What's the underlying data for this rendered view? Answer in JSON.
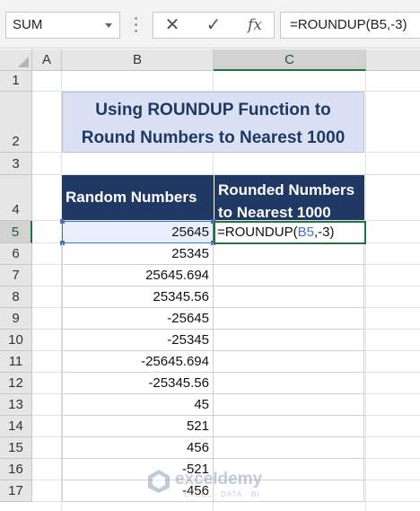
{
  "formula_bar": {
    "name_box": "SUM",
    "cancel_icon": "✕",
    "enter_icon": "✓",
    "fx_label": "fx",
    "formula": "=ROUNDUP(B5,-3)"
  },
  "columns": [
    "A",
    "B",
    "C"
  ],
  "rows": [
    "1",
    "2",
    "3",
    "4",
    "5",
    "6",
    "7",
    "8",
    "9",
    "10",
    "11",
    "12",
    "13",
    "14",
    "15",
    "16",
    "17"
  ],
  "title": {
    "line1": "Using ROUNDUP Function to",
    "line2": "Round Numbers to Nearest 1000"
  },
  "table": {
    "header_b": "Random Numbers",
    "header_c_line1": "Rounded Numbers",
    "header_c_line2": "to Nearest 1000",
    "values": [
      "25645",
      "25345",
      "25645.694",
      "25345.56",
      "-25645",
      "-25345",
      "-25645.694",
      "-25345.56",
      "45",
      "521",
      "456",
      "-521",
      "-456"
    ],
    "editing_cell": {
      "prefix": "=ROUNDUP(",
      "ref": "B5",
      "suffix": ",-3)"
    }
  },
  "watermark": {
    "name": "exceldemy",
    "tagline": "EXCEL · DATA · BI"
  },
  "colors": {
    "accent_green": "#217346",
    "title_fill": "#d9e1f2",
    "header_fill": "#203864",
    "ref_blue": "#4472c4"
  }
}
